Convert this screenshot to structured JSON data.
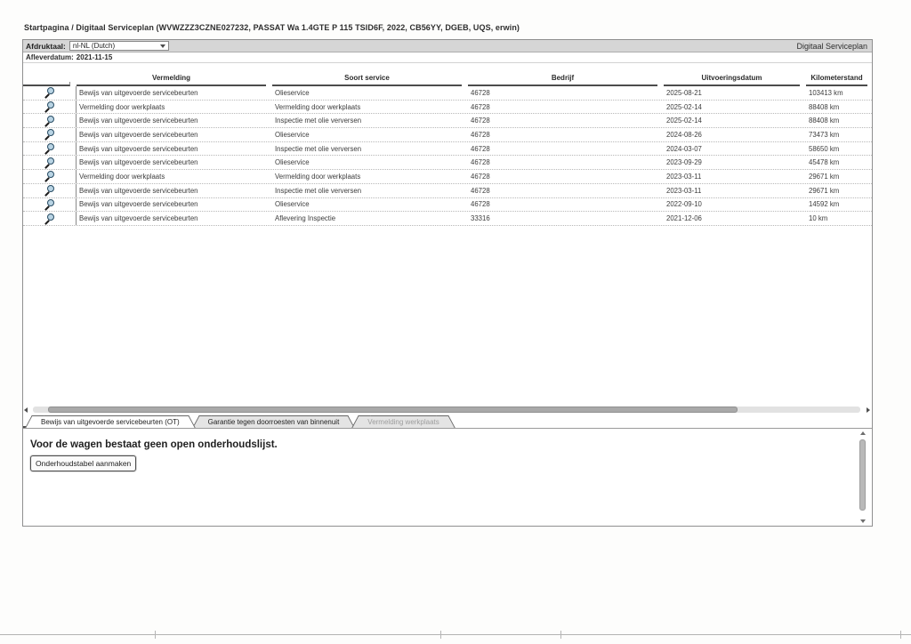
{
  "page": {
    "breadcrumb": "Startpagina / Digitaal Serviceplan (WVWZZZ3CZNE027232, PASSAT Wa 1.4GTE P 115 TSID6F, 2022, CB56YY, DGEB, UQS, erwin)",
    "title_right": "Digitaal Serviceplan"
  },
  "toolbar": {
    "print_language_label": "Afdruktaal:",
    "print_language_value": "nl-NL (Dutch)",
    "delivery_date_label": "Afleverdatum:",
    "delivery_date_value": "2021-11-15"
  },
  "table": {
    "columns": [
      "Vermelding",
      "Soort service",
      "Bedrijf",
      "Uitvoeringsdatum",
      "Kilometerstand"
    ],
    "row_icon": "magnifier-icon",
    "rows": [
      {
        "vermelding": "Bewijs van uitgevoerde servicebeurten",
        "soort": "Olieservice",
        "bedrijf": "46728",
        "datum": "2025-08-21",
        "km": "103413 km"
      },
      {
        "vermelding": "Vermelding door werkplaats",
        "soort": "Vermelding door werkplaats",
        "bedrijf": "46728",
        "datum": "2025-02-14",
        "km": "88408 km"
      },
      {
        "vermelding": "Bewijs van uitgevoerde servicebeurten",
        "soort": "Inspectie met olie verversen",
        "bedrijf": "46728",
        "datum": "2025-02-14",
        "km": "88408 km"
      },
      {
        "vermelding": "Bewijs van uitgevoerde servicebeurten",
        "soort": "Olieservice",
        "bedrijf": "46728",
        "datum": "2024-08-26",
        "km": "73473 km"
      },
      {
        "vermelding": "Bewijs van uitgevoerde servicebeurten",
        "soort": "Inspectie met olie verversen",
        "bedrijf": "46728",
        "datum": "2024-03-07",
        "km": "58650 km"
      },
      {
        "vermelding": "Bewijs van uitgevoerde servicebeurten",
        "soort": "Olieservice",
        "bedrijf": "46728",
        "datum": "2023-09-29",
        "km": "45478 km"
      },
      {
        "vermelding": "Vermelding door werkplaats",
        "soort": "Vermelding door werkplaats",
        "bedrijf": "46728",
        "datum": "2023-03-11",
        "km": "29671 km"
      },
      {
        "vermelding": "Bewijs van uitgevoerde servicebeurten",
        "soort": "Inspectie met olie verversen",
        "bedrijf": "46728",
        "datum": "2023-03-11",
        "km": "29671 km"
      },
      {
        "vermelding": "Bewijs van uitgevoerde servicebeurten",
        "soort": "Olieservice",
        "bedrijf": "46728",
        "datum": "2022-09-10",
        "km": "14592 km"
      },
      {
        "vermelding": "Bewijs van uitgevoerde servicebeurten",
        "soort": "Aflevering Inspectie",
        "bedrijf": "33316",
        "datum": "2021-12-06",
        "km": "10 km"
      }
    ]
  },
  "tabs": [
    {
      "label": "Bewijs van uitgevoerde servicebeurten (OT)",
      "state": "active"
    },
    {
      "label": "Garantie tegen doorroesten van binnenuit",
      "state": "normal"
    },
    {
      "label": "Vermelding werkplaats",
      "state": "disabled"
    }
  ],
  "panel": {
    "message": "Voor de wagen bestaat geen open onderhoudslijst.",
    "button_label": "Onderhoudstabel aanmaken"
  },
  "colors": {
    "toolbar_gray": "#d6d6d6",
    "tab_gray": "#e4e4e4",
    "scroll_thumb": "#a9a9a9",
    "magnifier_fill": "#b9d4e4",
    "magnifier_ring": "#274b63"
  }
}
